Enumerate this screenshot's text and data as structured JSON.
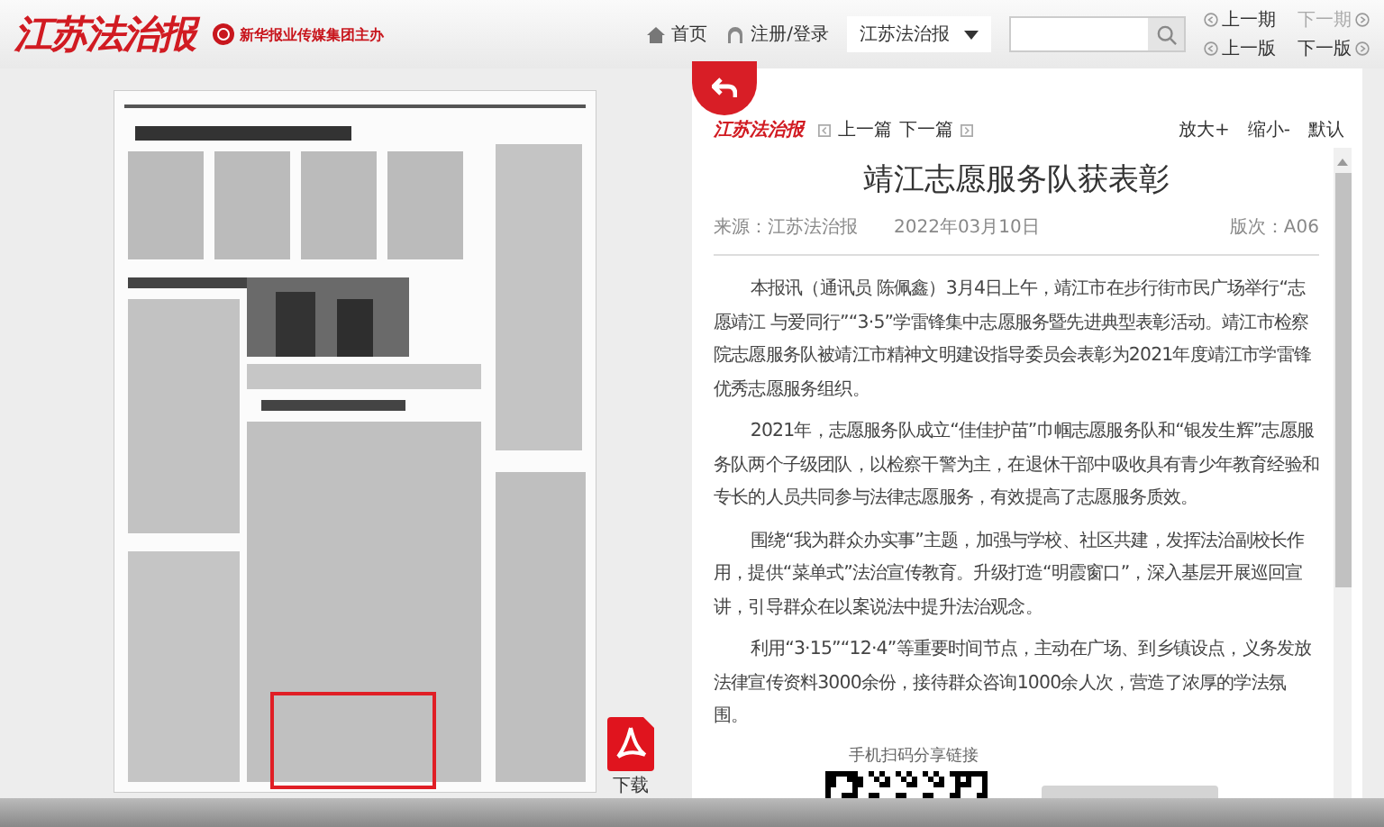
{
  "header": {
    "logo": "江苏法治报",
    "sponsor": "新华报业传媒集团主办",
    "nav": [
      {
        "kind": "home",
        "label": "首页"
      },
      {
        "kind": "user",
        "label": "注册/登录"
      }
    ],
    "paper_select": "江苏法治报",
    "issue_nav": [
      {
        "label": "上一期",
        "kind": "prev",
        "disabled": false
      },
      {
        "label": "下一期",
        "kind": "next",
        "disabled": true
      },
      {
        "label": "上一版",
        "kind": "prev",
        "disabled": false
      },
      {
        "label": "下一版",
        "kind": "next",
        "disabled": false
      }
    ]
  },
  "page_view": {
    "kind": "picture",
    "download": "下载"
  },
  "article_toolbar": {
    "logo": "江苏法治报",
    "prev": "上一篇",
    "next": "下一篇",
    "zoom": [
      "放大+",
      "缩小-",
      "默认"
    ]
  },
  "article": {
    "title": "靖江志愿服务队获表彰",
    "source": "来源：江苏法治报",
    "date": "2022年03月10日",
    "edition": "版次：A06",
    "paragraphs": [
      "本报讯（通讯员 陈佩鑫）3月4日上午，靖江市在步行街市民广场举行“志愿靖江 与爱同行”“3·5”学雷锋集中志愿服务暨先进典型表彰活动。靖江市检察院志愿服务队被靖江市精神文明建设指导委员会表彰为2021年度靖江市学雷锋优秀志愿服务组织。",
      "2021年，志愿服务队成立“佳佳护苗”巾帼志愿服务队和“银发生辉”志愿服务队两个子级团队，以检察干警为主，在退休干部中吸收具有青少年教育经验和专长的人员共同参与法律志愿服务，有效提高了志愿服务质效。",
      "围绕“我为群众办实事”主题，加强与学校、社区共建，发挥法治副校长作用，提供“菜单式”法治宣传教育。升级打造“明霞窗口”，深入基层开展巡回宣讲，引导群众在以案说法中提升法治观念。",
      "利用“3·15”“12·4”等重要时间节点，主动在广场、到乡镇设点，义务发放法律宣传资料3000余份，接待群众咨询1000余人次，营造了浓厚的学法氛围。"
    ],
    "share_label": "手机扫码分享链接"
  }
}
